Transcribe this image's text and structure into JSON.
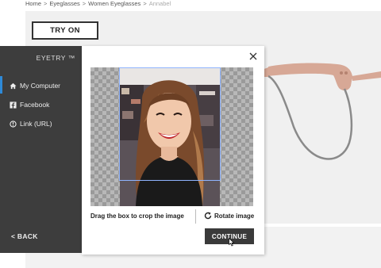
{
  "breadcrumb": {
    "items": [
      "Home",
      "Eyeglasses",
      "Women Eyeglasses"
    ],
    "separator": ">",
    "current": "Annabel"
  },
  "product": {
    "try_on_label": "TRY ON",
    "frame_color": "#d7a896"
  },
  "eyetry": {
    "brand": "EYETRY ™",
    "nav": [
      {
        "label": "My Computer",
        "icon": "home-icon",
        "active": true
      },
      {
        "label": "Facebook",
        "icon": "facebook-icon",
        "active": false
      },
      {
        "label": "Link (URL)",
        "icon": "link-icon",
        "active": false
      }
    ],
    "back_label": "< BACK",
    "accent_color": "#2e8ad8"
  },
  "crop": {
    "hint": "Drag the box to crop the image",
    "rotate_label": "Rotate image",
    "continue_label": "CONTINUE"
  }
}
